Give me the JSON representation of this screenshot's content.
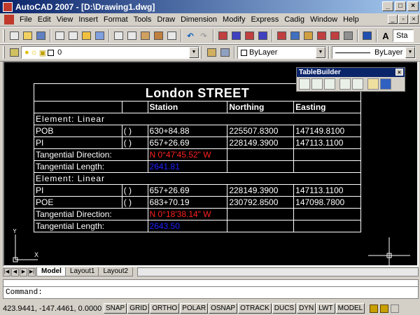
{
  "window": {
    "title": "AutoCAD 2007 - [D:\\Drawing1.dwg]"
  },
  "menu": [
    "File",
    "Edit",
    "View",
    "Insert",
    "Format",
    "Tools",
    "Draw",
    "Dimension",
    "Modify",
    "Express",
    "Cadig",
    "Window",
    "Help"
  ],
  "toolbar2": {
    "layer_value": "0",
    "color_value": "ByLayer",
    "linetype_value": "ByLayer"
  },
  "toolbar1": {
    "style_combo": "Sta"
  },
  "palette": {
    "title": "TableBuilder"
  },
  "table": {
    "title": "London STREET",
    "headers": [
      "",
      "",
      "Station",
      "Northing",
      "Easting"
    ],
    "element1": "Element:  Linear",
    "rows1": [
      [
        "POB",
        "( )",
        "630+84.88",
        "225507.8300",
        "147149.8100"
      ],
      [
        "PI",
        "( )",
        "657+26.69",
        "228149.3900",
        "147113.1100"
      ]
    ],
    "tdir1_label": "Tangential Direction:",
    "tdir1_value": "N 0°47'45.52\" W",
    "tlen1_label": "Tangential Length:",
    "tlen1_value": "2641.81",
    "element2": "Element:  Linear",
    "rows2": [
      [
        "PI",
        "( )",
        "657+26.69",
        "228149.3900",
        "147113.1100"
      ],
      [
        "POE",
        "( )",
        "683+70.19",
        "230792.8500",
        "147098.7800"
      ]
    ],
    "tdir2_label": "Tangential Direction:",
    "tdir2_value": "N 0°18'38.14\" W",
    "tlen2_label": "Tangential Length:",
    "tlen2_value": "2643.50"
  },
  "ucs": {
    "x": "X",
    "y": "Y"
  },
  "tabs": [
    "Model",
    "Layout1",
    "Layout2"
  ],
  "command": {
    "prompt": "Command:"
  },
  "status": {
    "coords": "423.9441, -147.4461, 0.0000",
    "buttons": [
      "SNAP",
      "GRID",
      "ORTHO",
      "POLAR",
      "OSNAP",
      "OTRACK",
      "DUCS",
      "DYN",
      "LWT",
      "MODEL"
    ]
  },
  "colors": {
    "title_start": "#0a246a",
    "title_end": "#a6caf0",
    "canvas": "#000000",
    "direction_text": "#ff2020",
    "length_text": "#2020ff"
  }
}
